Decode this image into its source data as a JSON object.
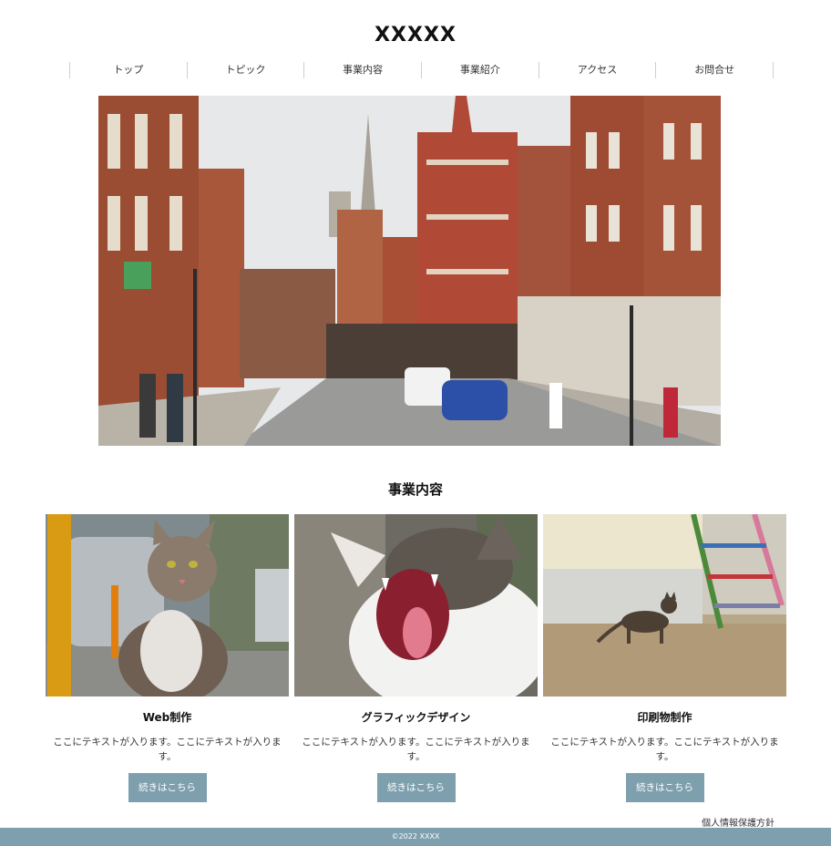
{
  "site": {
    "title": "XXXXX"
  },
  "nav": {
    "items": [
      {
        "label": "トップ"
      },
      {
        "label": "トピック"
      },
      {
        "label": "事業内容"
      },
      {
        "label": "事業紹介"
      },
      {
        "label": "アクセス"
      },
      {
        "label": "お問合せ"
      }
    ]
  },
  "hero": {
    "alt": "street-photo"
  },
  "services": {
    "title": "事業内容",
    "cards": [
      {
        "title": "Web制作",
        "text": "ここにテキストが入ります。ここにテキストが入ります。",
        "button": "続きはこちら"
      },
      {
        "title": "グラフィックデザイン",
        "text": "ここにテキストが入ります。ここにテキストが入ります。",
        "button": "続きはこちら"
      },
      {
        "title": "印刷物制作",
        "text": "ここにテキストが入ります。ここにテキストが入ります。",
        "button": "続きはこちら"
      }
    ]
  },
  "footer": {
    "privacy": "個人情報保護方針",
    "copyright": "©2022 XXXX"
  },
  "colors": {
    "accent": "#7d9fae"
  }
}
